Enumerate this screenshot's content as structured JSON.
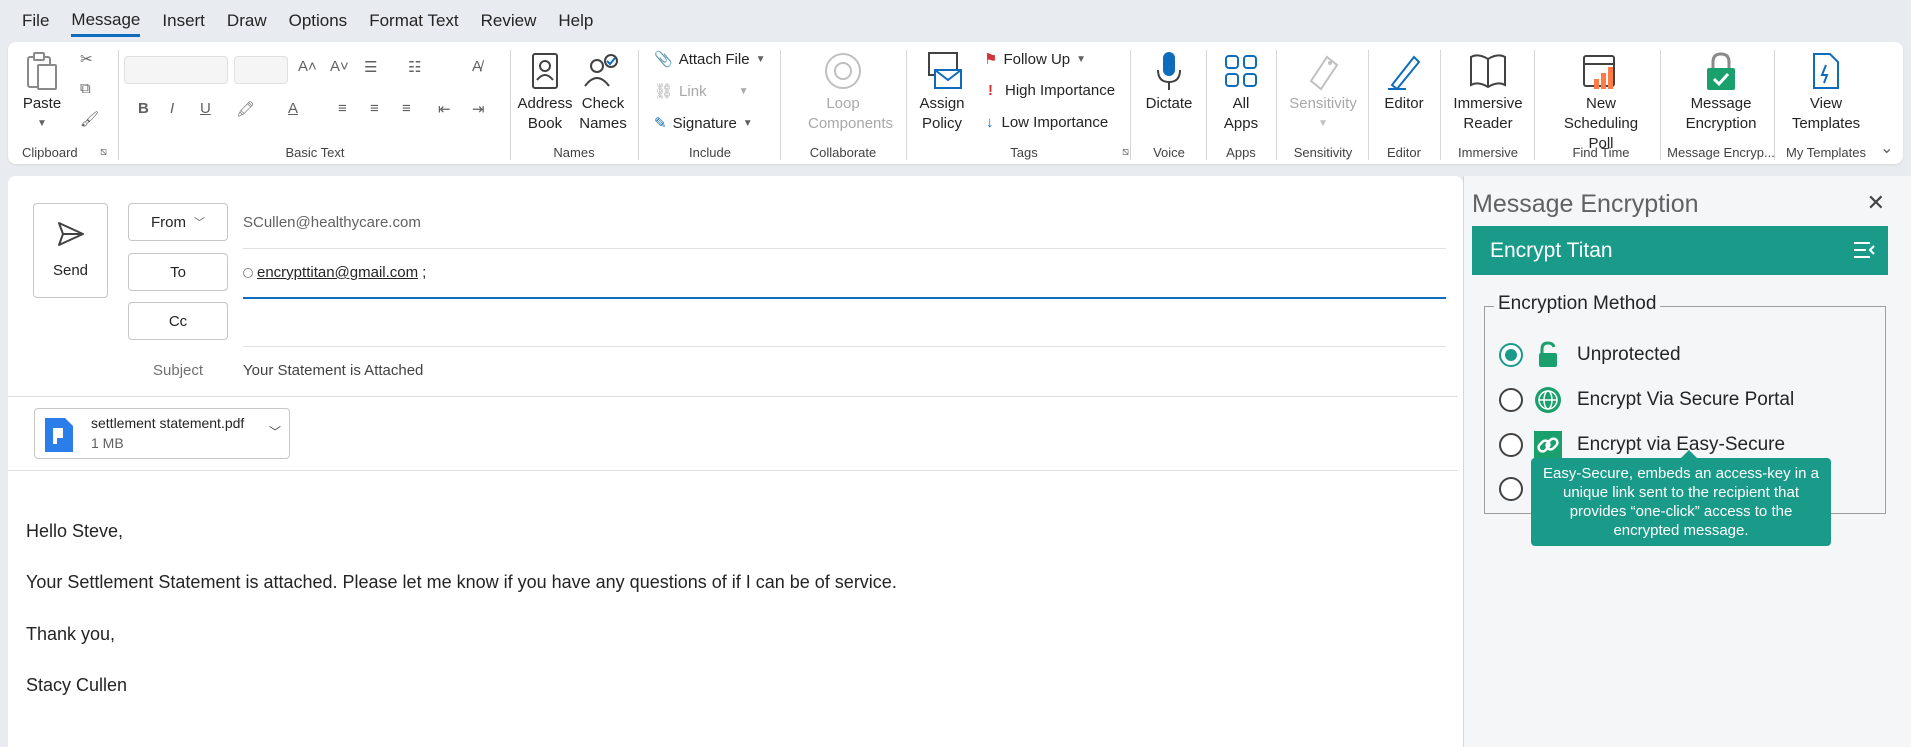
{
  "menu": {
    "items": [
      "File",
      "Message",
      "Insert",
      "Draw",
      "Options",
      "Format Text",
      "Review",
      "Help"
    ],
    "active": "Message"
  },
  "ribbon": {
    "clipboard": {
      "paste": "Paste",
      "label": "Clipboard"
    },
    "basic_text": {
      "label": "Basic Text"
    },
    "names": {
      "address_book": "Address Book",
      "check_names": "Check Names",
      "label": "Names"
    },
    "include": {
      "attach_file": "Attach File",
      "link": "Link",
      "signature": "Signature",
      "label": "Include"
    },
    "collaborate": {
      "loop": "Loop Components",
      "label": "Collaborate"
    },
    "tags": {
      "assign_policy": "Assign Policy",
      "follow_up": "Follow Up",
      "high_importance": "High Importance",
      "low_importance": "Low Importance",
      "label": "Tags"
    },
    "voice": {
      "dictate": "Dictate",
      "label": "Voice"
    },
    "apps": {
      "all_apps": "All Apps",
      "label": "Apps"
    },
    "sensitivity": {
      "sensitivity": "Sensitivity",
      "label": "Sensitivity"
    },
    "editor": {
      "editor": "Editor",
      "label": "Editor"
    },
    "immersive": {
      "reader": "Immersive Reader",
      "label": "Immersive"
    },
    "find_time": {
      "poll": "New Scheduling Poll",
      "label": "Find Time"
    },
    "encryption": {
      "btn": "Message Encryption",
      "label": "Message Encryp..."
    },
    "templates": {
      "btn": "View Templates",
      "label": "My Templates"
    }
  },
  "compose": {
    "send": "Send",
    "from_label": "From",
    "from_value": "SCullen@healthycare.com",
    "to_label": "To",
    "to_value": "encrypttitan@gmail.com",
    "to_sep": ";",
    "cc_label": "Cc",
    "subject_label": "Subject",
    "subject_value": "Your Statement is Attached",
    "attachment": {
      "name": "settlement statement.pdf",
      "size": "1 MB"
    },
    "body": [
      "Hello Steve,",
      "Your Settlement Statement is attached.  Please let me know if you have any questions of if I can be of service.",
      "Thank you,",
      "Stacy Cullen"
    ]
  },
  "pane": {
    "title": "Message Encryption",
    "header": "Encrypt Titan",
    "method_legend": "Encryption Method",
    "options": [
      "Unprotected",
      "Encrypt Via Secure Portal",
      "Encrypt via Easy-Secure"
    ],
    "selected": "Unprotected",
    "tooltip": "Easy-Secure, embeds an access-key in a unique link sent to the recipient that provides “one-click” access to the encrypted message."
  },
  "colors": {
    "accent": "#0f6cbd",
    "teal": "#1a9b8a"
  }
}
